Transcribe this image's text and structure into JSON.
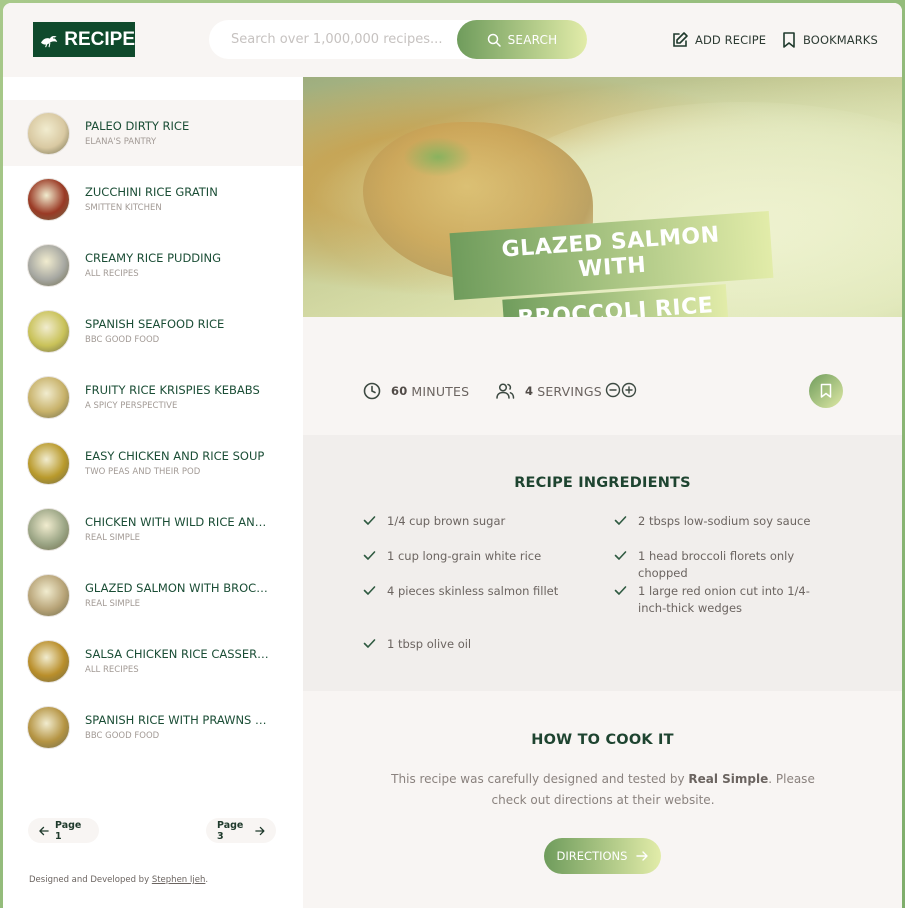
{
  "header": {
    "logo_text": "RECIPE",
    "search_placeholder": "Search over 1,000,000 recipes...",
    "search_button": "SEARCH",
    "nav_add": "ADD RECIPE",
    "nav_bookmarks": "BOOKMARKS"
  },
  "sidebar": {
    "results": [
      {
        "title": "PALEO DIRTY RICE",
        "publisher": "ELANA'S PANTRY",
        "active": true,
        "color": "#d9c9a2"
      },
      {
        "title": "ZUCCHINI RICE GRATIN",
        "publisher": "SMITTEN KITCHEN",
        "color": "#9a3a25"
      },
      {
        "title": "CREAMY RICE PUDDING",
        "publisher": "ALL RECIPES",
        "color": "#a7a8a2"
      },
      {
        "title": "SPANISH SEAFOOD RICE",
        "publisher": "BBC GOOD FOOD",
        "color": "#c9c259"
      },
      {
        "title": "FRUITY RICE KRISPIES KEBABS",
        "publisher": "A SPICY PERSPECTIVE",
        "color": "#c8b26a"
      },
      {
        "title": "EASY CHICKEN AND RICE SOUP",
        "publisher": "TWO PEAS AND THEIR POD",
        "color": "#b99a2c"
      },
      {
        "title": "CHICKEN WITH WILD RICE AND G...",
        "publisher": "REAL SIMPLE",
        "color": "#9ca686"
      },
      {
        "title": "GLAZED SALMON WITH BROCCOL...",
        "publisher": "REAL SIMPLE",
        "color": "#b8a478"
      },
      {
        "title": "SALSA CHICKEN RICE CASSEROLE",
        "publisher": "ALL RECIPES",
        "color": "#b98e2a"
      },
      {
        "title": "SPANISH RICE WITH PRAWNS & C...",
        "publisher": "BBC GOOD FOOD",
        "color": "#b59443"
      }
    ],
    "pagination": {
      "prev": "Page 1",
      "next": "Page 3"
    },
    "credit_prefix": "Designed and Developed by ",
    "credit_name": "Stephen Ijeh",
    "credit_suffix": "."
  },
  "recipe": {
    "title_line1": "GLAZED SALMON WITH",
    "title_line2": "BROCCOLI RICE",
    "minutes_value": "60",
    "minutes_label": "MINUTES",
    "servings_value": "4",
    "servings_label": "SERVINGS",
    "ingredients_title": "RECIPE INGREDIENTS",
    "ingredients": [
      "1/4 cup brown sugar",
      "2 tbsps low-sodium soy sauce",
      "1 cup long-grain white rice",
      "1 head broccoli florets only chopped",
      "4 pieces skinless salmon fillet",
      "1 large red onion cut into 1/4-inch-thick wedges",
      "1 tbsp olive oil"
    ],
    "howto_title": "HOW TO COOK IT",
    "howto_prefix": "This recipe was carefully designed and tested by ",
    "howto_publisher": "Real Simple",
    "howto_suffix": ". Please check out directions at their website.",
    "directions_button": "DIRECTIONS"
  },
  "colors": {
    "brand_dark": "#0f4a2c",
    "gradient_start": "#6f9c5c",
    "gradient_end": "#e2eca9"
  }
}
